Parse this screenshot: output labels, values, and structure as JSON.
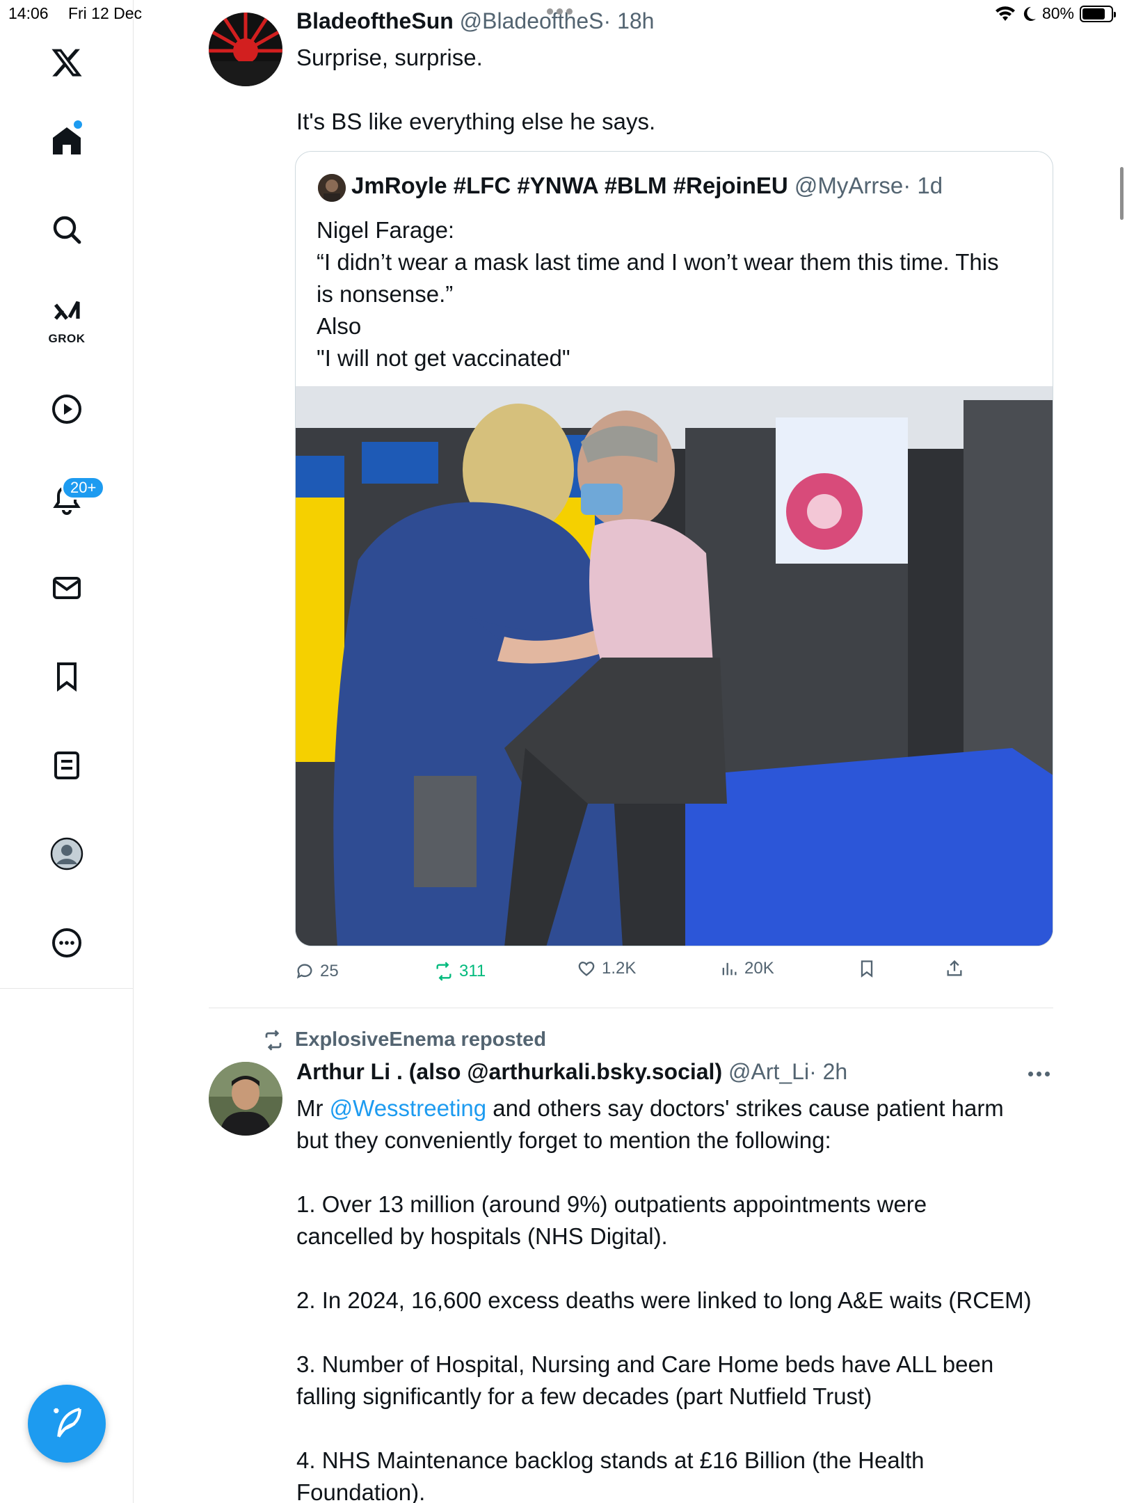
{
  "status_bar": {
    "time": "14:06",
    "date": "Fri 12 Dec",
    "battery": "80%"
  },
  "sidebar": {
    "items": [
      {
        "name": "x-logo-icon"
      },
      {
        "name": "home-icon"
      },
      {
        "name": "search-icon"
      },
      {
        "name": "grok-icon",
        "label": "GROK"
      },
      {
        "name": "video-icon"
      },
      {
        "name": "notifications-icon",
        "badge": "20+"
      },
      {
        "name": "messages-icon"
      },
      {
        "name": "bookmarks-icon"
      },
      {
        "name": "lists-icon"
      },
      {
        "name": "profile-icon"
      },
      {
        "name": "more-icon"
      }
    ],
    "compose_icon": "compose-icon"
  },
  "tweet1": {
    "name": "BladeoftheSun",
    "handle": "@BladeoftheS",
    "time": "· 18h",
    "text": "Surprise, surprise.\n\nIt's BS like everything else he says.",
    "quote": {
      "name": "JmRoyle #LFC #YNWA #BLM #RejoinEU",
      "handle": "@MyArrse",
      "time": "· 1d",
      "text": "Nigel Farage:\n“I didn’t wear a mask last time and I won’t wear them this time. This\nis nonsense.”\nAlso\n\"I will not get vaccinated\""
    },
    "actions": {
      "replies": "25",
      "reposts": "311",
      "likes": "1.2K",
      "views": "20K"
    }
  },
  "tweet2": {
    "reposted_by": "ExplosiveEnema reposted",
    "name": "Arthur Li . (also @arthurkali.bsky.social)",
    "handle": "@Art_Li",
    "time": "· 2h",
    "text_prefix": "Mr ",
    "mention": "@Wesstreeting",
    "text_line1_rest": " and others say doctors' strikes cause patient harm",
    "text_rest": "but they conveniently forget to mention the following:\n\n1. Over 13 million (around 9%) outpatients appointments were\ncancelled by hospitals (NHS Digital).\n\n2. In 2024, 16,600 excess deaths were linked to long A&E waits (RCEM)\n\n3. Number of Hospital, Nursing and Care Home beds have ALL been\nfalling significantly for a few decades (part Nutfield Trust)\n\n4. NHS Maintenance backlog stands at £16 Billion (the Health\nFoundation)."
  }
}
